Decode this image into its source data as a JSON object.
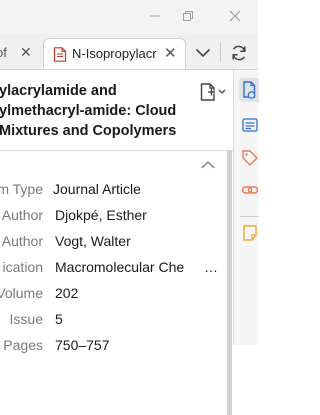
{
  "window": {
    "minimize_icon": "minimize-icon",
    "restore_icon": "restore-icon",
    "close_icon": "close-icon"
  },
  "tabs": [
    {
      "label": "of",
      "active": false
    },
    {
      "label": "N-Isopropylacr",
      "active": true,
      "icon": "document-icon"
    }
  ],
  "item": {
    "title_lines": [
      "ylacrylamide and",
      "ylmethacryl-amide: Cloud",
      "Mixtures and Copolymers"
    ],
    "fields": [
      {
        "label": "m Type",
        "value": "Journal Article"
      },
      {
        "label": "Author",
        "value": "Djokpé, Esther"
      },
      {
        "label": "Author",
        "value": "Vogt, Walter"
      },
      {
        "label": "ication",
        "value": "Macromolecular Che",
        "truncated": true,
        "ellipsis": "…"
      },
      {
        "label": "Volume",
        "value": "202"
      },
      {
        "label": "Issue",
        "value": "5"
      },
      {
        "label": "Pages",
        "value": "750–757"
      }
    ]
  },
  "colors": {
    "accent": "#2f6fce",
    "tab_close_icon_color": "#555555",
    "sidebar_tag_color": "#e87d55",
    "sidebar_note_color": "#f0a63a"
  }
}
